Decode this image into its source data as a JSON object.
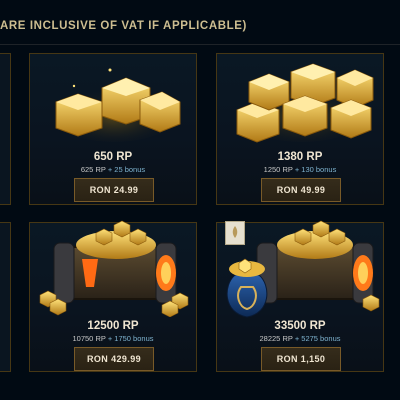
{
  "store": {
    "vat_notice": "ARE INCLUSIVE OF VAT IF APPLICABLE)"
  },
  "bundles": [
    {
      "title": "650 RP",
      "base": "625 RP",
      "bonus": "+ 25 bonus",
      "price": "RON 24.99"
    },
    {
      "title": "1380 RP",
      "base": "1250 RP",
      "bonus": "+ 130 bonus",
      "price": "RON 49.99"
    },
    {
      "title": "12500 RP",
      "base": "10750 RP",
      "bonus": "+ 1750 bonus",
      "price": "RON 429.99"
    },
    {
      "title": "33500 RP",
      "base": "28225 RP",
      "bonus": "+ 5275 bonus",
      "price": "RON 1,150"
    }
  ],
  "colors": {
    "background": "#010a13",
    "gold_border": "#463714",
    "button_border": "#785a28",
    "bonus_text": "#7fb3cf",
    "title_text": "#f0e6d2"
  },
  "icons": [
    "rp-gold-stack-icon",
    "rp-treasure-chest-icon",
    "rp-treasure-bag-icon",
    "best-value-badge-icon"
  ]
}
